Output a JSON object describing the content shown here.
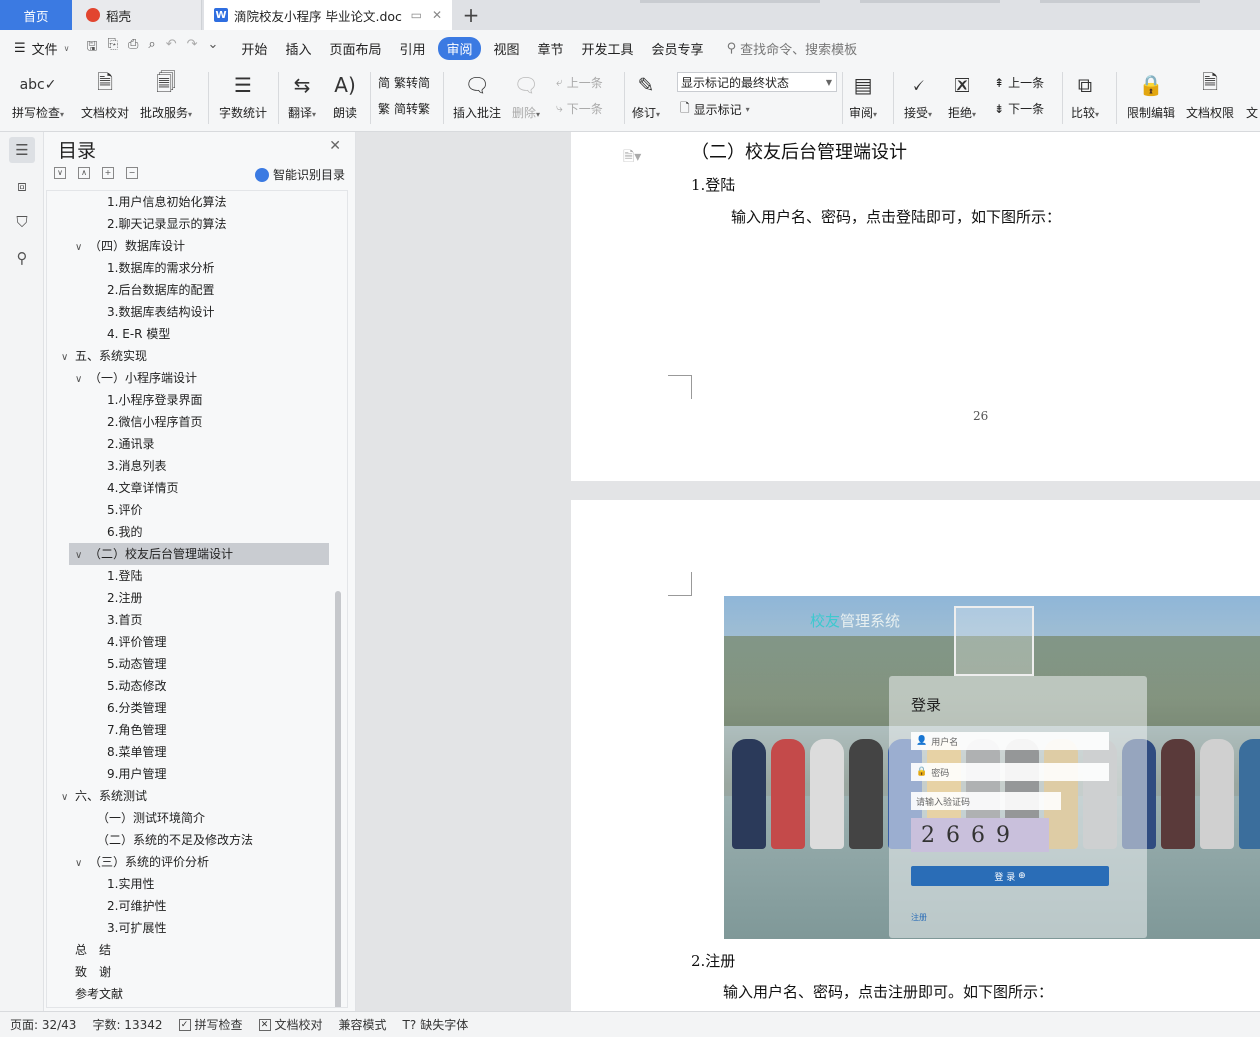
{
  "tabs": {
    "home": "首页",
    "daoke": "稻壳",
    "doc": "滴院校友小程序 毕业论文.doc",
    "new_tab": "+"
  },
  "menu": {
    "file": "文件",
    "items": [
      "开始",
      "插入",
      "页面布局",
      "引用",
      "审阅",
      "视图",
      "章节",
      "开发工具",
      "会员专享"
    ],
    "active": "审阅",
    "search": "查找命令、搜索模板"
  },
  "ribbon": {
    "spell": "拼写检查",
    "proof": "文档校对",
    "revise_service": "批改服务",
    "wordcount": "字数统计",
    "translate": "翻译",
    "read": "朗读",
    "to_trad": "繁转简",
    "to_simp": "简转繁",
    "insert_comment": "插入批注",
    "delete": "删除",
    "prev_comment": "上一条",
    "next_comment": "下一条",
    "track": "修订",
    "markup_state": "显示标记的最终状态",
    "show_markup": "显示标记",
    "review": "审阅",
    "accept": "接受",
    "reject": "拒绝",
    "prev": "上一条",
    "next": "下一条",
    "compare": "比较",
    "restrict": "限制编辑",
    "doc_rights": "文档权限",
    "more": "文"
  },
  "toc": {
    "title": "目录",
    "smart": "智能识别目录",
    "items": [
      {
        "text": "1.用户信息初始化算法",
        "level": 3
      },
      {
        "text": "2.聊天记录显示的算法",
        "level": 3
      },
      {
        "text": "（四）数据库设计",
        "level": 2,
        "chev": "∨"
      },
      {
        "text": "1.数据库的需求分析",
        "level": 3
      },
      {
        "text": "2.后台数据库的配置",
        "level": 3
      },
      {
        "text": "3.数据库表结构设计",
        "level": 3
      },
      {
        "text": "4. E-R 模型",
        "level": 3
      },
      {
        "text": "五、系统实现",
        "level": 1,
        "chev": "∨"
      },
      {
        "text": "（一）小程序端设计",
        "level": 2,
        "chev": "∨"
      },
      {
        "text": "1.小程序登录界面",
        "level": 3
      },
      {
        "text": "2.微信小程序首页",
        "level": 3
      },
      {
        "text": "2.通讯录",
        "level": 3
      },
      {
        "text": "3.消息列表",
        "level": 3
      },
      {
        "text": "4.文章详情页",
        "level": 3
      },
      {
        "text": "5.评价",
        "level": 3
      },
      {
        "text": "6.我的",
        "level": 3
      },
      {
        "text": "（二）校友后台管理端设计",
        "level": 2,
        "chev": "∨",
        "selected": true
      },
      {
        "text": "1.登陆",
        "level": 3
      },
      {
        "text": "2.注册",
        "level": 3
      },
      {
        "text": "3.首页",
        "level": 3
      },
      {
        "text": "4.评价管理",
        "level": 3
      },
      {
        "text": "5.动态管理",
        "level": 3
      },
      {
        "text": "5.动态修改",
        "level": 3
      },
      {
        "text": "6.分类管理",
        "level": 3
      },
      {
        "text": "7.角色管理",
        "level": 3
      },
      {
        "text": "8.菜单管理",
        "level": 3
      },
      {
        "text": "9.用户管理",
        "level": 3
      },
      {
        "text": "六、系统测试",
        "level": 1,
        "chev": "∨"
      },
      {
        "text": "（一）测试环境简介",
        "level": 2
      },
      {
        "text": "（二）系统的不足及修改方法",
        "level": 2
      },
      {
        "text": "（三）系统的评价分析",
        "level": 2,
        "chev": "∨"
      },
      {
        "text": "1.实用性",
        "level": 3
      },
      {
        "text": "2.可维护性",
        "level": 3
      },
      {
        "text": "3.可扩展性",
        "level": 3
      },
      {
        "text": "总　结",
        "level": 0
      },
      {
        "text": "致　谢",
        "level": 0
      },
      {
        "text": "参考文献",
        "level": 0
      }
    ]
  },
  "doc": {
    "heading": "（二）校友后台管理端设计",
    "sub1": "1.登陆",
    "para1": "输入用户名、密码，点击登陆即可，如下图所示：",
    "page_number": "26",
    "sub2": "2.注册",
    "para2": "输入用户名、密码，点击注册即可。如下图所示：",
    "figure": {
      "brand_a": "校友",
      "brand_b": "管理系统",
      "login_title": "登录",
      "username": "用户名",
      "password": "密码",
      "captcha_placeholder": "请输入验证码",
      "captcha": "2 6 6 9",
      "login_button": "登 录",
      "register": "注册"
    }
  },
  "status": {
    "page": "页面: 32/43",
    "words": "字数: 13342",
    "spell": "拼写检查",
    "proof": "文档校对",
    "compat": "兼容模式",
    "missing_font": "缺失字体"
  }
}
